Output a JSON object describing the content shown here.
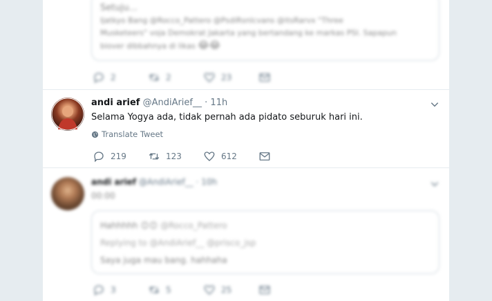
{
  "top_tweet": {
    "text_line1": "Setuju...",
    "text_line2": "Ijatkyo Bang @Rocco_Pattero @PsdiRsnlcvans @itsRarvx \"Three",
    "text_line3": "Musketeers\" voja Demokrat Jakarta yang bertandang ke markas PSI. Sapapun",
    "text_line4": "biover dibbahnya di likas",
    "emoji": "😂😂",
    "reply_count": "2",
    "retweet_count": "2",
    "like_count": "23"
  },
  "main_tweet": {
    "name": "andi arief",
    "handle": "@AndiArief__",
    "separator": "·",
    "time": "11h",
    "text": "Selama Yogya ada, tidak pernah ada pidato seburuk hari ini.",
    "translate_label": "Translate Tweet",
    "reply_count": "219",
    "retweet_count": "123",
    "like_count": "612"
  },
  "bottom_tweet": {
    "name": "andi arief",
    "handle": "@AndiArief__",
    "separator": "·",
    "time": "10h",
    "text": "00:00",
    "quote": {
      "name": "Hahhhhh",
      "emoji": "😊😊",
      "handle": "@Rocco_Pattero",
      "replying": "Replying to @AndiArief__ @prisco_jsp",
      "text": "Saya juga mau bang. hahhaha"
    },
    "reply_count": "3",
    "retweet_count": "5",
    "like_count": "25"
  },
  "colors": {
    "background": "#e6ecf0",
    "text": "#14171a",
    "muted": "#657786",
    "border": "#e6ecf0",
    "accent": "#1da1f2"
  }
}
